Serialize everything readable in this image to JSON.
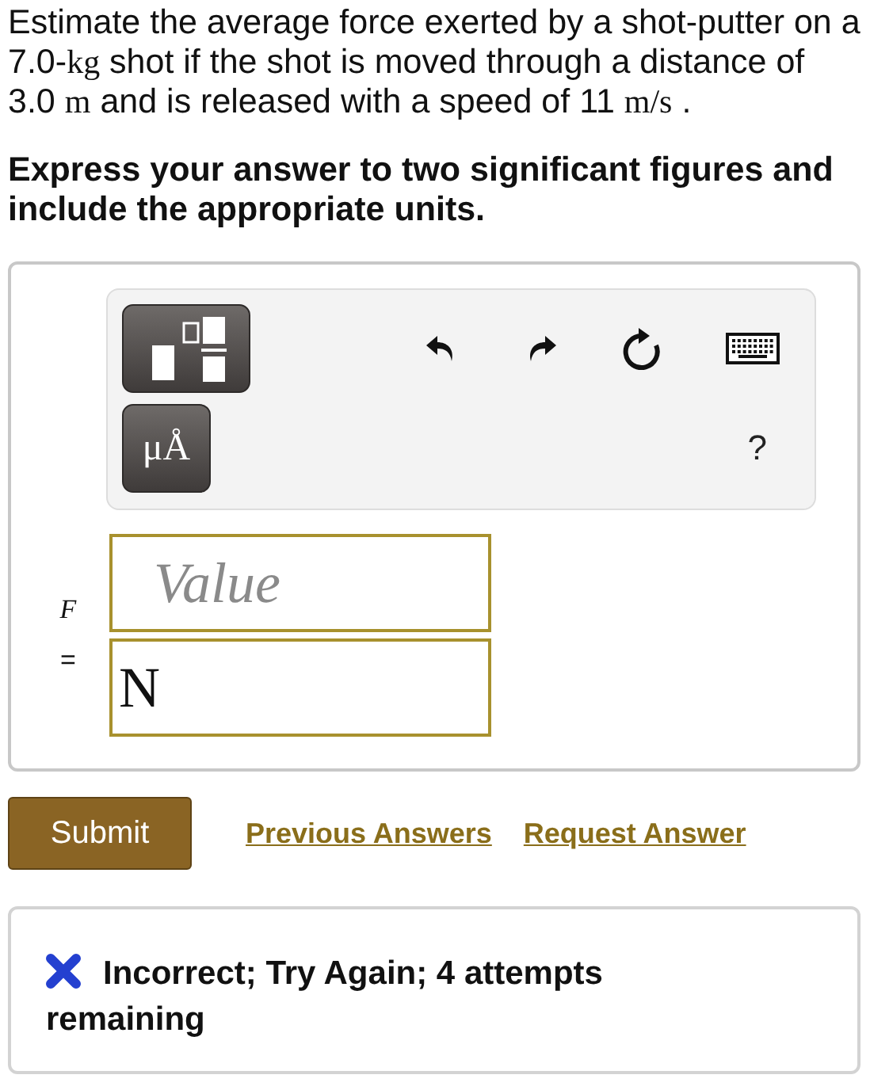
{
  "question": {
    "parts": [
      {
        "kind": "text",
        "text": "Estimate the average force exerted by a shot-putter on a 7.0-"
      },
      {
        "kind": "math",
        "text": "kg"
      },
      {
        "kind": "text",
        "text": " shot if the shot is moved through a distance of 3.0 "
      },
      {
        "kind": "math",
        "text": " m"
      },
      {
        "kind": "text",
        "text": " and is released with a speed of 11 "
      },
      {
        "kind": "math",
        "text": " m/s"
      },
      {
        "kind": "text",
        "text": " ."
      }
    ]
  },
  "instruction": "Express your answer to two significant figures and include the appropriate units.",
  "toolbar": {
    "units_button": "μÅ",
    "help": "?"
  },
  "answer": {
    "variable": "F",
    "equals": "=",
    "value_placeholder": "Value",
    "unit_value": "N"
  },
  "actions": {
    "submit": "Submit",
    "links": [
      "Previous Answers",
      "Request Answer"
    ]
  },
  "feedback": {
    "correct": false,
    "message": "Incorrect; Try Again; 4 attempts remaining"
  }
}
